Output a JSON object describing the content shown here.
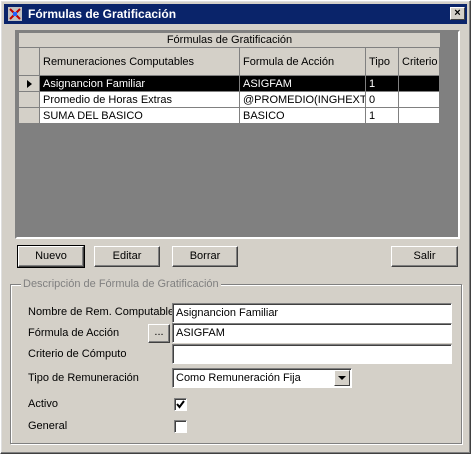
{
  "window": {
    "title": "Fórmulas de Gratificación",
    "close_label": "×"
  },
  "grid": {
    "caption": "Fórmulas de Gratificación",
    "columns": [
      "Remuneraciones Computables",
      "Formula de Acción",
      "Tipo",
      "Criterio"
    ],
    "rows": [
      {
        "name": "Asignancion Familiar",
        "formula": "ASIGFAM",
        "tipo": "1",
        "criterio": "",
        "selected": true
      },
      {
        "name": "Promedio de Horas Extras",
        "formula": "@PROMEDIO(INGHEXTRA",
        "tipo": "0",
        "criterio": "",
        "selected": false
      },
      {
        "name": "SUMA DEL BASICO",
        "formula": "BASICO",
        "tipo": "1",
        "criterio": "",
        "selected": false
      }
    ]
  },
  "buttons": {
    "nuevo": "Nuevo",
    "editar": "Editar",
    "borrar": "Borrar",
    "salir": "Salir"
  },
  "form": {
    "group_title": "Descripción de Fórmula de Gratificación",
    "nombre_label": "Nombre de Rem. Computable",
    "nombre_value": "Asignancion Familiar",
    "formula_label": "Fórmula de Acción",
    "formula_browse": "...",
    "formula_value": "ASIGFAM",
    "criterio_label": "Criterio de Cómputo",
    "criterio_value": "",
    "tipo_label": "Tipo de Remuneración",
    "tipo_value": "Como Remuneración Fija",
    "activo_label": "Activo",
    "activo_checked": true,
    "general_label": "General",
    "general_checked": false
  }
}
